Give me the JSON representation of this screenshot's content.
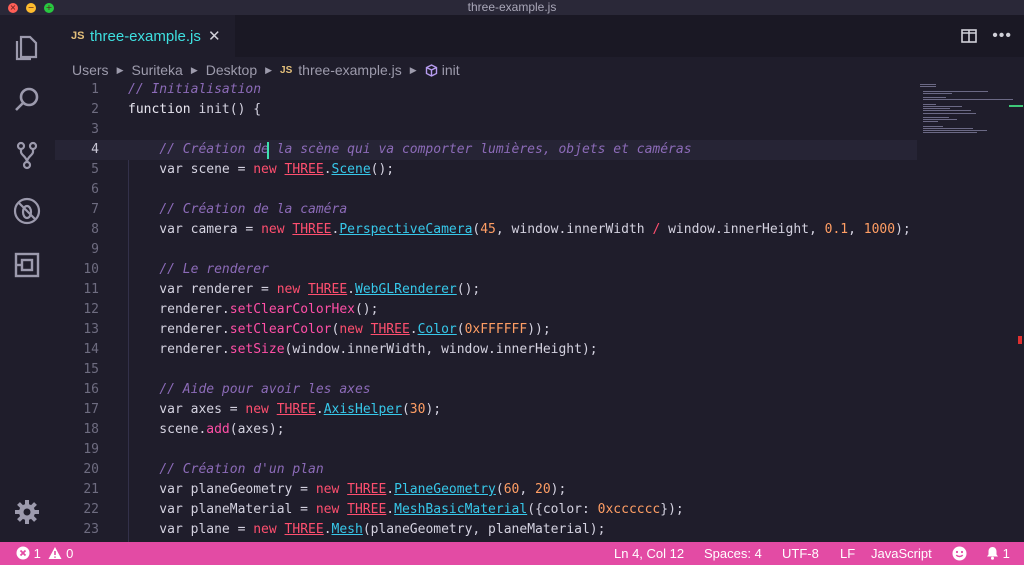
{
  "window": {
    "title": "three-example.js"
  },
  "tab": {
    "lang": "JS",
    "label": "three-example.js",
    "close": "✕"
  },
  "breadcrumbs": {
    "items": [
      "Users",
      "Suriteka",
      "Desktop"
    ],
    "file_lang": "JS",
    "file": "three-example.js",
    "symbol": "init"
  },
  "editor": {
    "lines": [
      {
        "n": "1",
        "tokens": [
          [
            "c-cmt",
            "// Initialisation"
          ]
        ]
      },
      {
        "n": "2",
        "tokens": [
          [
            "c-kw",
            "function "
          ],
          [
            "c-txt",
            "init() {"
          ]
        ]
      },
      {
        "n": "3",
        "tokens": []
      },
      {
        "n": "4",
        "tokens": [
          [
            "c-txt",
            "    "
          ],
          [
            "c-cmt",
            "// Création de la scène qui va comporter lumières, objets et caméras"
          ]
        ]
      },
      {
        "n": "5",
        "tokens": [
          [
            "c-txt",
            "    var scene = "
          ],
          [
            "c-new",
            "new "
          ],
          [
            "c-three",
            "THREE"
          ],
          [
            "c-txt",
            "."
          ],
          [
            "c-cls",
            "Scene"
          ],
          [
            "c-txt",
            "();"
          ]
        ]
      },
      {
        "n": "6",
        "tokens": []
      },
      {
        "n": "7",
        "tokens": [
          [
            "c-txt",
            "    "
          ],
          [
            "c-cmt",
            "// Création de la caméra"
          ]
        ]
      },
      {
        "n": "8",
        "tokens": [
          [
            "c-txt",
            "    var camera = "
          ],
          [
            "c-new",
            "new "
          ],
          [
            "c-three",
            "THREE"
          ],
          [
            "c-txt",
            "."
          ],
          [
            "c-cls",
            "PerspectiveCamera"
          ],
          [
            "c-txt",
            "("
          ],
          [
            "c-num",
            "45"
          ],
          [
            "c-txt",
            ", window.innerWidth "
          ],
          [
            "c-op",
            "/"
          ],
          [
            "c-txt",
            " window.innerHeight, "
          ],
          [
            "c-num",
            "0.1"
          ],
          [
            "c-txt",
            ", "
          ],
          [
            "c-num",
            "1000"
          ],
          [
            "c-txt",
            ");"
          ]
        ]
      },
      {
        "n": "9",
        "tokens": []
      },
      {
        "n": "10",
        "tokens": [
          [
            "c-txt",
            "    "
          ],
          [
            "c-cmt",
            "// Le renderer"
          ]
        ]
      },
      {
        "n": "11",
        "tokens": [
          [
            "c-txt",
            "    var renderer = "
          ],
          [
            "c-new",
            "new "
          ],
          [
            "c-three",
            "THREE"
          ],
          [
            "c-txt",
            "."
          ],
          [
            "c-cls",
            "WebGLRenderer"
          ],
          [
            "c-txt",
            "();"
          ]
        ]
      },
      {
        "n": "12",
        "tokens": [
          [
            "c-txt",
            "    renderer."
          ],
          [
            "c-meth",
            "setClearColorHex"
          ],
          [
            "c-txt",
            "();"
          ]
        ]
      },
      {
        "n": "13",
        "tokens": [
          [
            "c-txt",
            "    renderer."
          ],
          [
            "c-meth",
            "setClearColor"
          ],
          [
            "c-txt",
            "("
          ],
          [
            "c-new",
            "new "
          ],
          [
            "c-three",
            "THREE"
          ],
          [
            "c-txt",
            "."
          ],
          [
            "c-cls",
            "Color"
          ],
          [
            "c-txt",
            "("
          ],
          [
            "c-num",
            "0xFFFFFF"
          ],
          [
            "c-txt",
            "));"
          ]
        ]
      },
      {
        "n": "14",
        "tokens": [
          [
            "c-txt",
            "    renderer."
          ],
          [
            "c-meth",
            "setSize"
          ],
          [
            "c-txt",
            "(window.innerWidth, window.innerHeight);"
          ]
        ]
      },
      {
        "n": "15",
        "tokens": []
      },
      {
        "n": "16",
        "tokens": [
          [
            "c-txt",
            "    "
          ],
          [
            "c-cmt",
            "// Aide pour avoir les axes"
          ]
        ]
      },
      {
        "n": "17",
        "tokens": [
          [
            "c-txt",
            "    var axes = "
          ],
          [
            "c-new",
            "new "
          ],
          [
            "c-three",
            "THREE"
          ],
          [
            "c-txt",
            "."
          ],
          [
            "c-cls",
            "AxisHelper"
          ],
          [
            "c-txt",
            "("
          ],
          [
            "c-num",
            "30"
          ],
          [
            "c-txt",
            ");"
          ]
        ]
      },
      {
        "n": "18",
        "tokens": [
          [
            "c-txt",
            "    scene."
          ],
          [
            "c-meth",
            "add"
          ],
          [
            "c-txt",
            "(axes);"
          ]
        ]
      },
      {
        "n": "19",
        "tokens": []
      },
      {
        "n": "20",
        "tokens": [
          [
            "c-txt",
            "    "
          ],
          [
            "c-cmt",
            "// Création d'un plan"
          ]
        ]
      },
      {
        "n": "21",
        "tokens": [
          [
            "c-txt",
            "    var planeGeometry = "
          ],
          [
            "c-new",
            "new "
          ],
          [
            "c-three",
            "THREE"
          ],
          [
            "c-txt",
            "."
          ],
          [
            "c-cls",
            "PlaneGeometry"
          ],
          [
            "c-txt",
            "("
          ],
          [
            "c-num",
            "60"
          ],
          [
            "c-txt",
            ", "
          ],
          [
            "c-num",
            "20"
          ],
          [
            "c-txt",
            ");"
          ]
        ]
      },
      {
        "n": "22",
        "tokens": [
          [
            "c-txt",
            "    var planeMaterial = "
          ],
          [
            "c-new",
            "new "
          ],
          [
            "c-three",
            "THREE"
          ],
          [
            "c-txt",
            "."
          ],
          [
            "c-cls",
            "MeshBasicMaterial"
          ],
          [
            "c-txt",
            "({color: "
          ],
          [
            "c-num",
            "0xcccccc"
          ],
          [
            "c-txt",
            "});"
          ]
        ]
      },
      {
        "n": "23",
        "tokens": [
          [
            "c-txt",
            "    var plane = "
          ],
          [
            "c-new",
            "new "
          ],
          [
            "c-three",
            "THREE"
          ],
          [
            "c-txt",
            "."
          ],
          [
            "c-cls",
            "Mesh"
          ],
          [
            "c-txt",
            "(planeGeometry, planeMaterial);"
          ]
        ]
      }
    ],
    "active_line": "4"
  },
  "statusbar": {
    "errors": "1",
    "warnings": "0",
    "position": "Ln 4, Col 12",
    "spaces": "Spaces: 4",
    "encoding": "UTF-8",
    "eol": "LF",
    "language": "JavaScript",
    "notifications": "1"
  },
  "colors": {
    "statusbar": "#e34ba4",
    "accent": "#3ee0e0",
    "keyword_new": "#ff4f6f",
    "comment": "#8c6bb8"
  },
  "icons": [
    "explorer-icon",
    "search-icon",
    "source-control-icon",
    "debug-icon",
    "extensions-icon",
    "settings-gear-icon",
    "split-editor-icon",
    "more-actions-icon",
    "smiley-feedback-icon",
    "bell-icon"
  ]
}
